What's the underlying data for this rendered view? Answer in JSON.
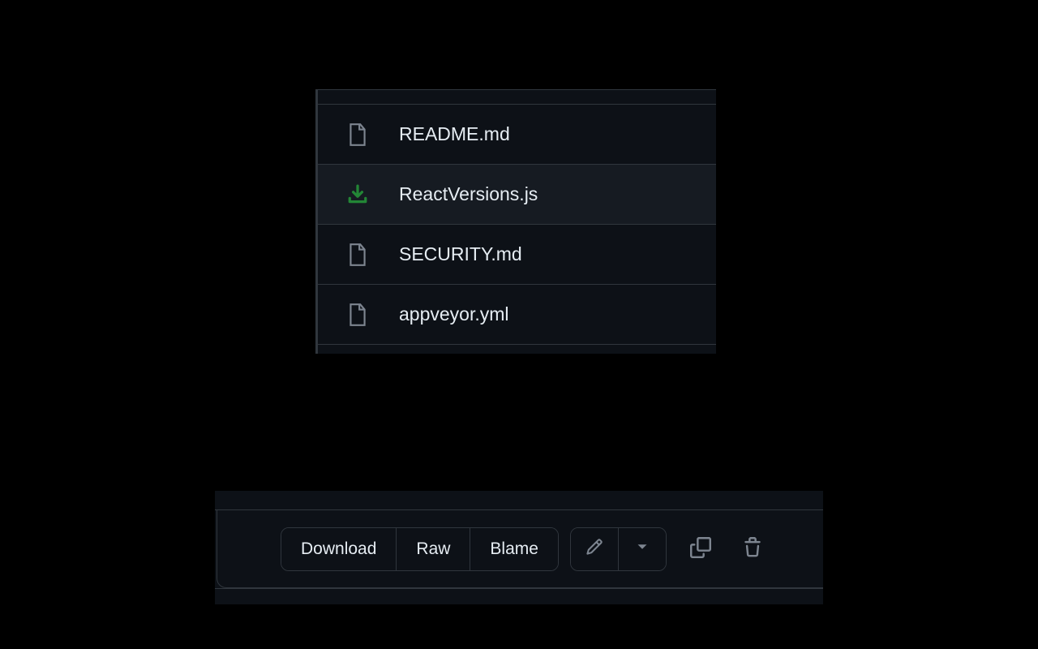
{
  "file_list": {
    "items": [
      {
        "name": "README.md",
        "icon": "file",
        "selected": false
      },
      {
        "name": "ReactVersions.js",
        "icon": "download",
        "selected": true
      },
      {
        "name": "SECURITY.md",
        "icon": "file",
        "selected": false
      },
      {
        "name": "appveyor.yml",
        "icon": "file",
        "selected": false
      }
    ]
  },
  "toolbar": {
    "download_label": "Download",
    "raw_label": "Raw",
    "blame_label": "Blame"
  }
}
